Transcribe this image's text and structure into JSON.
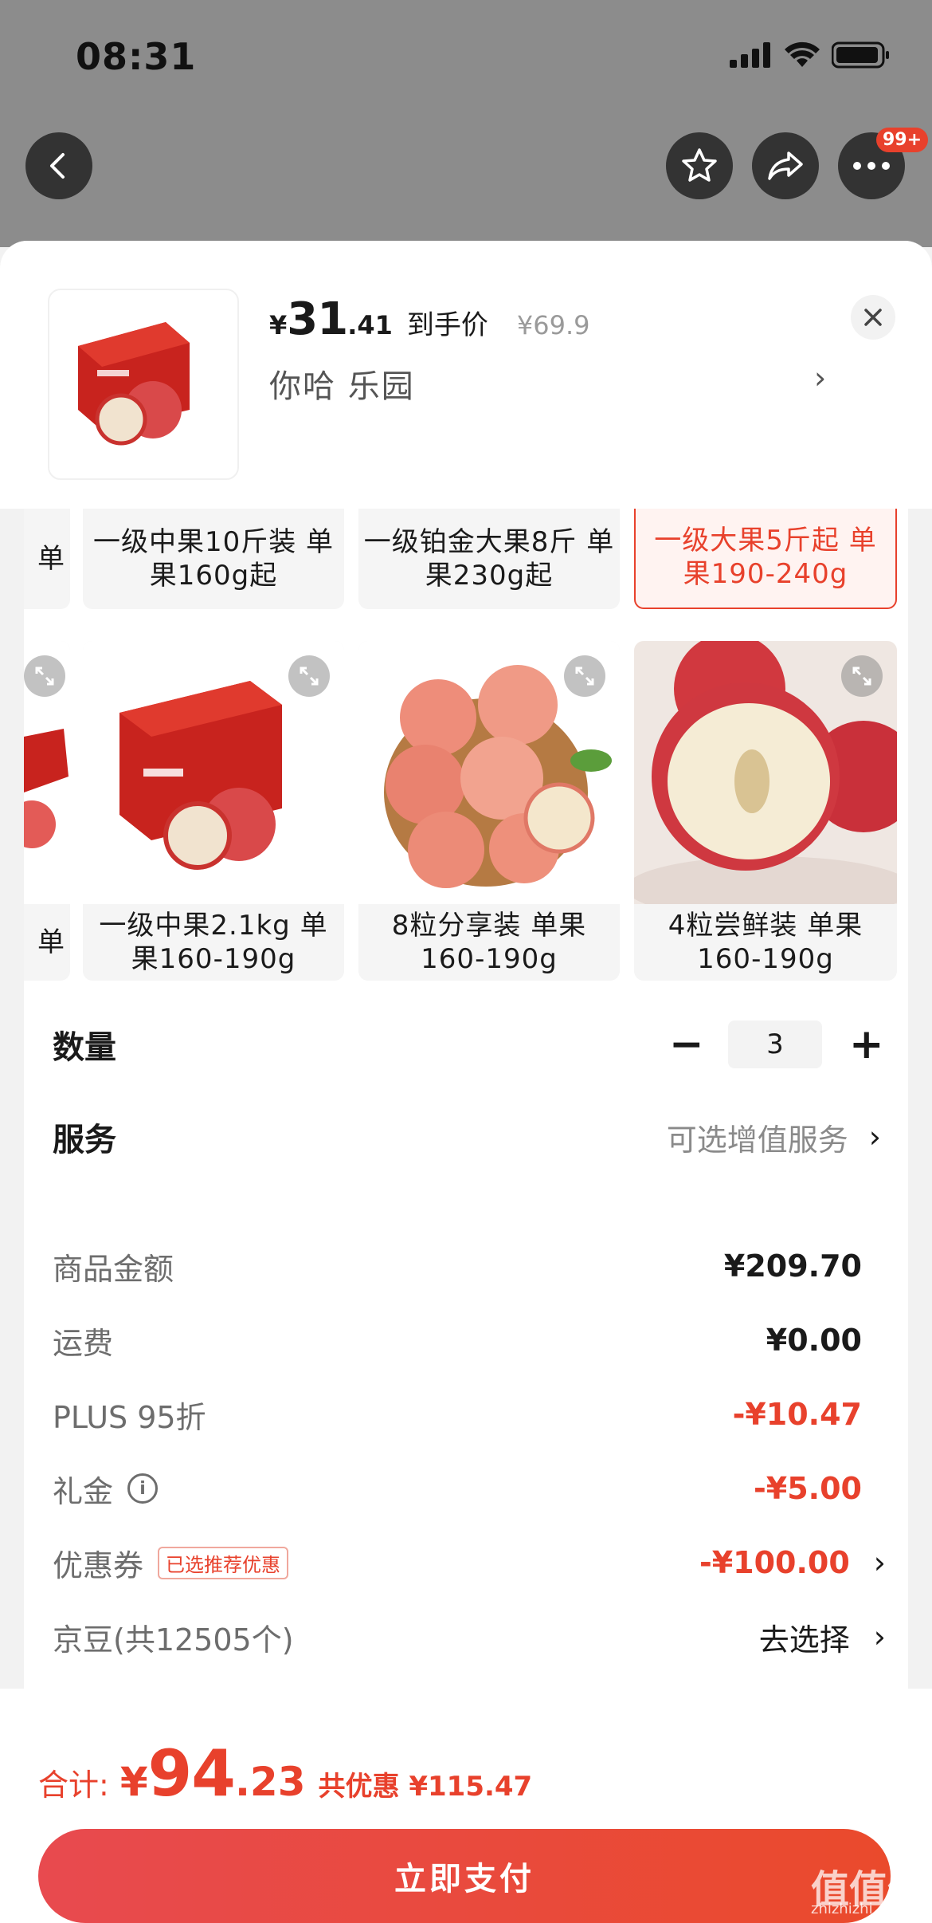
{
  "status_bar": {
    "time": "08:31"
  },
  "nav": {
    "badge": "99+"
  },
  "header": {
    "price_yen": "¥",
    "price_int": "31",
    "price_dec": ".41",
    "price_label": "到手价",
    "original_price": "¥69.9",
    "variant": "你哈  乐园",
    "variant_chevron": "›"
  },
  "options": {
    "row1": [
      {
        "label": "单"
      },
      {
        "label": "一级中果10斤装 单果160g起"
      },
      {
        "label": "一级铂金大果8斤 单果230g起"
      },
      {
        "label": "一级大果5斤起 单果190-240g",
        "selected": true
      }
    ],
    "row2": [
      {
        "label": "单"
      },
      {
        "label": "一级中果2.1kg 单果160-190g"
      },
      {
        "label": "8粒分享装 单果160-190g"
      },
      {
        "label": "4粒尝鲜装 单果160-190g"
      }
    ]
  },
  "quantity": {
    "label": "数量",
    "minus": "−",
    "value": "3",
    "plus": "+"
  },
  "service": {
    "label": "服务",
    "value": "可选增值服务",
    "chevron": "›"
  },
  "summary": [
    {
      "label": "商品金额",
      "value": "¥209.70",
      "red": false
    },
    {
      "label": "运费",
      "value": "¥0.00",
      "red": false
    },
    {
      "label": "PLUS 95折",
      "value": "-¥10.47",
      "red": true
    },
    {
      "label": "礼金",
      "value": "-¥5.00",
      "red": true,
      "info_icon": "i"
    },
    {
      "label": "优惠券",
      "tag": "已选推荐优惠",
      "value": "-¥100.00",
      "red": true,
      "chevron": "›"
    },
    {
      "label": "京豆(共12505个)",
      "value": "去选择",
      "red": false,
      "chevron": "›"
    }
  ],
  "footer": {
    "total_label": "合计:",
    "total_yen": "¥",
    "total_int": "94",
    "total_dec": ".23",
    "savings": "共优惠 ¥115.47",
    "pay_button": "立即支付"
  },
  "watermark": {
    "text": "值值值",
    "sub": "zhizhizhi.com"
  },
  "colors": {
    "accent": "#e8412c",
    "sheet_bg": "#f2f2f2",
    "dim": "#8c8c8c"
  }
}
